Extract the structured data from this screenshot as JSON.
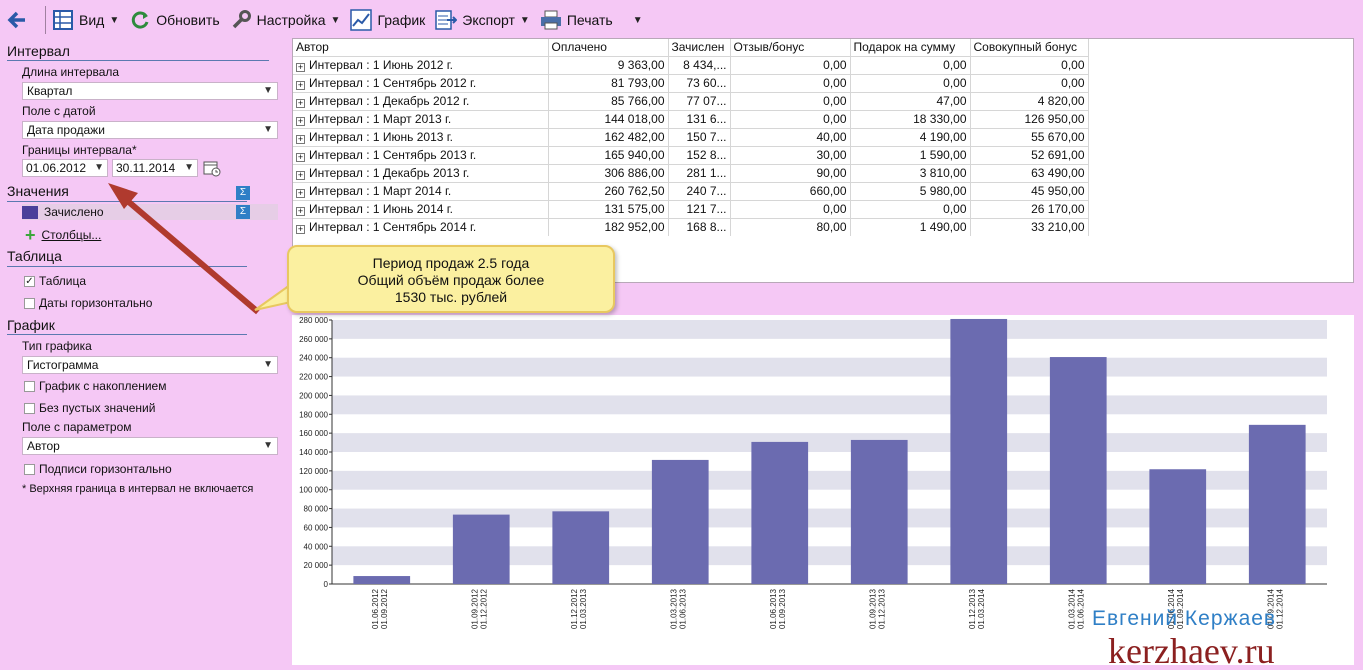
{
  "toolbar": {
    "back_label": "",
    "view_label": "Вид",
    "refresh_label": "Обновить",
    "settings_label": "Настройка",
    "chart_label": "График",
    "export_label": "Экспорт",
    "print_label": "Печать"
  },
  "left": {
    "interval_title": "Интервал",
    "interval_length_label": "Длина интервала",
    "interval_length_value": "Квартал",
    "date_field_label": "Поле с датой",
    "date_field_value": "Дата продажи",
    "bounds_label": "Границы интервала*",
    "date_from": "01.06.2012",
    "date_to": "30.11.2014",
    "values_title": "Значения",
    "sigma": "Σ",
    "value_item": "Зачислено",
    "columns_link": "Столбцы...",
    "table_title": "Таблица",
    "table_checkbox": "Таблица",
    "dates_horizontal": "Даты горизонтально",
    "chart_title": "График",
    "chart_type_label": "Тип графика",
    "chart_type_value": "Гистограмма",
    "cumulative": "График с накоплением",
    "no_empty": "Без пустых значений",
    "param_field_label": "Поле с параметром",
    "param_field_value": "Автор",
    "labels_horizontal": "Подписи горизонтально",
    "footnote": "* Верхняя граница в интервал не включается"
  },
  "table": {
    "columns": [
      "Автор",
      "Оплачено",
      "Зачислен",
      "Отзыв/бонус",
      "Подарок на сумму",
      "Совокупный бонус"
    ],
    "rows": [
      [
        "Интервал : 1 Июнь 2012 г.",
        "9 363,00",
        "8 434,...",
        "0,00",
        "0,00",
        "0,00"
      ],
      [
        "Интервал : 1 Сентябрь 2012 г.",
        "81 793,00",
        "73 60...",
        "0,00",
        "0,00",
        "0,00"
      ],
      [
        "Интервал : 1 Декабрь 2012 г.",
        "85 766,00",
        "77 07...",
        "0,00",
        "47,00",
        "4 820,00"
      ],
      [
        "Интервал : 1 Март 2013 г.",
        "144 018,00",
        "131 6...",
        "0,00",
        "18 330,00",
        "126 950,00"
      ],
      [
        "Интервал : 1 Июнь 2013 г.",
        "162 482,00",
        "150 7...",
        "40,00",
        "4 190,00",
        "55 670,00"
      ],
      [
        "Интервал : 1 Сентябрь 2013 г.",
        "165 940,00",
        "152 8...",
        "30,00",
        "1 590,00",
        "52 691,00"
      ],
      [
        "Интервал : 1 Декабрь 2013 г.",
        "306 886,00",
        "281 1...",
        "90,00",
        "3 810,00",
        "63 490,00"
      ],
      [
        "Интервал : 1 Март 2014 г.",
        "260 762,50",
        "240 7...",
        "660,00",
        "5 980,00",
        "45 950,00"
      ],
      [
        "Интервал : 1 Июнь 2014 г.",
        "131 575,00",
        "121 7...",
        "0,00",
        "0,00",
        "26 170,00"
      ],
      [
        "Интервал : 1 Сентябрь 2014 г.",
        "182 952,00",
        "168 8...",
        "80,00",
        "1 490,00",
        "33 210,00"
      ]
    ]
  },
  "callout": {
    "line1": "Период продаж 2.5 года",
    "line2": "Общий объём продаж более",
    "line3": "1530 тыс. рублей"
  },
  "watermark": {
    "name": "Евгений Кержаев",
    "site": "kerzhaev.ru"
  },
  "chart_data": {
    "type": "bar",
    "bar_color": "#6b6bb0",
    "band_color": "#e1e1ec",
    "ylim": [
      0,
      280000
    ],
    "ytick_labels": [
      "0",
      "20 000",
      "40 000",
      "60 000",
      "80 000",
      "100 000",
      "120 000",
      "140 000",
      "160 000",
      "180 000",
      "200 000",
      "220 000",
      "240 000",
      "260 000",
      "280 000"
    ],
    "categories": [
      [
        "01.06.2012",
        "01.09.2012"
      ],
      [
        "01.09.2012",
        "01.12.2012"
      ],
      [
        "01.12.2012",
        "01.03.2013"
      ],
      [
        "01.03.2013",
        "01.06.2013"
      ],
      [
        "01.06.2013",
        "01.09.2013"
      ],
      [
        "01.09.2013",
        "01.12.2013"
      ],
      [
        "01.12.2013",
        "01.03.2014"
      ],
      [
        "01.03.2014",
        "01.06.2014"
      ],
      [
        "01.06.2014",
        "01.09.2014"
      ],
      [
        "01.09.2014",
        "01.12.2014"
      ]
    ],
    "series": [
      {
        "values": [
          8434,
          73600,
          77070,
          131600,
          150700,
          152800,
          281100,
          240700,
          121700,
          168800
        ]
      }
    ]
  }
}
